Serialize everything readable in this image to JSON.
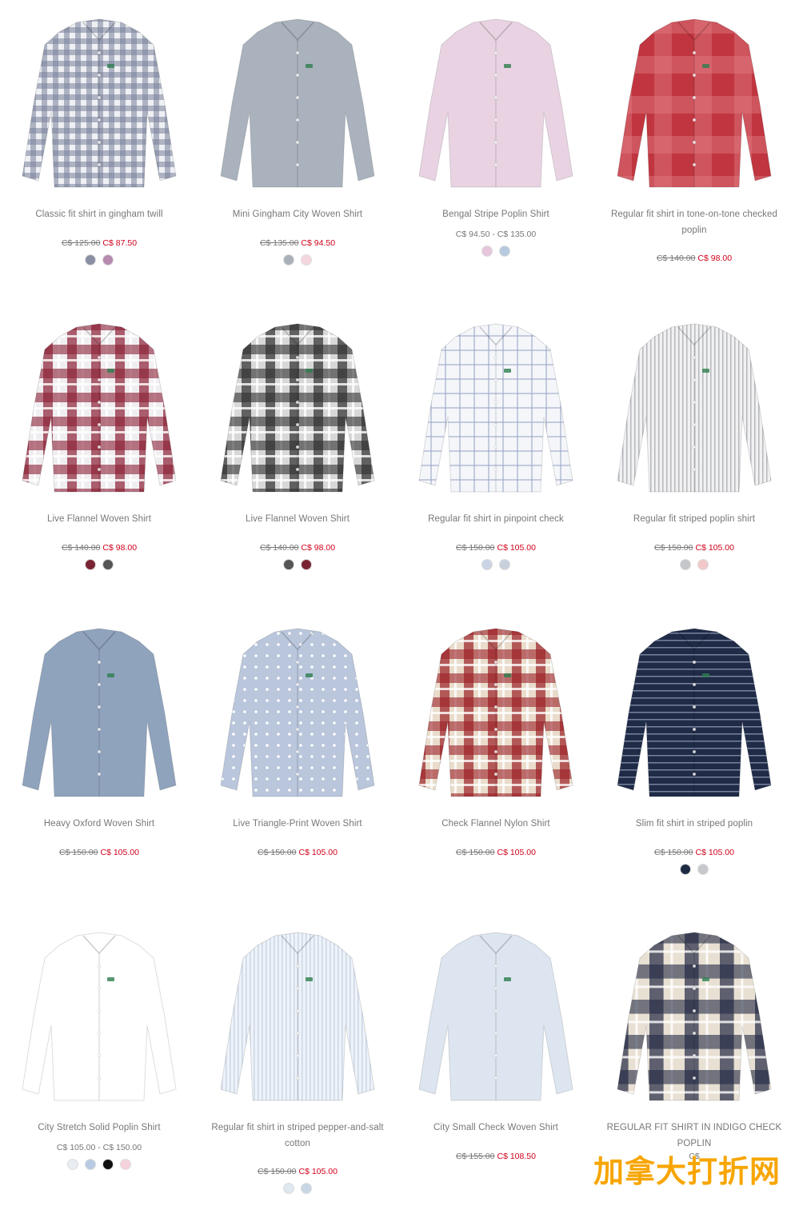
{
  "products": [
    {
      "name": "Classic fit shirt in gingham twill",
      "price_old": "C$ 125.00",
      "price_new": "C$ 87.50",
      "swatches": [
        "#8a8fa3",
        "#b78ab0"
      ],
      "shirt": {
        "base": "#eef0f4",
        "line": "#7a829a",
        "pattern": "gingham"
      }
    },
    {
      "name": "Mini Gingham City Woven Shirt",
      "price_old": "C$ 135.00",
      "price_new": "C$ 94.50",
      "swatches": [
        "#a9b0b8",
        "#f4d7de"
      ],
      "shirt": {
        "base": "#a9b2bd",
        "line": "#8f99a5",
        "pattern": "solid"
      }
    },
    {
      "name": "Bengal Stripe Poplin Shirt",
      "price_range": "C$ 94.50 - C$ 135.00",
      "swatches": [
        "#e5c6dc",
        "#b7c9de"
      ],
      "shirt": {
        "base": "#e9d3e3",
        "line": "#d6bdd0",
        "pattern": "solid"
      }
    },
    {
      "name": "Regular fit shirt in tone-on-tone checked poplin",
      "price_old": "C$ 140.00",
      "price_new": "C$ 98.00",
      "swatches": [],
      "shirt": {
        "base": "#c0353f",
        "line": "#e07a83",
        "pattern": "bigcheck"
      }
    },
    {
      "name": "Live Flannel Woven Shirt",
      "price_old": "C$ 140.00",
      "price_new": "C$ 98.00",
      "swatches": [
        "#7a2433",
        "#555555"
      ],
      "shirt": {
        "base": "#f1eef2",
        "line": "#8b1f34",
        "pattern": "tartan"
      }
    },
    {
      "name": "Live Flannel Woven Shirt",
      "price_old": "C$ 140.00",
      "price_new": "C$ 98.00",
      "swatches": [
        "#555555",
        "#7a2433"
      ],
      "shirt": {
        "base": "#d8d8d8",
        "line": "#2f2f2f",
        "pattern": "tartan"
      }
    },
    {
      "name": "Regular fit shirt in pinpoint check",
      "price_old": "C$ 150.00",
      "price_new": "C$ 105.00",
      "swatches": [
        "#c9d4e4",
        "#c8d0dc"
      ],
      "shirt": {
        "base": "#f4f6fa",
        "line": "#9aa8c4",
        "pattern": "check"
      }
    },
    {
      "name": "Regular fit striped poplin shirt",
      "price_old": "C$ 150.00",
      "price_new": "C$ 105.00",
      "swatches": [
        "#c4c6ca",
        "#f2c8c8"
      ],
      "shirt": {
        "base": "#f1f1f1",
        "line": "#9a9ea6",
        "pattern": "vstripe"
      }
    },
    {
      "name": "Heavy Oxford Woven Shirt",
      "price_old": "C$ 150.00",
      "price_new": "C$ 105.00",
      "swatches": [],
      "shirt": {
        "base": "#8fa3bd",
        "line": "#7e92ad",
        "pattern": "solid"
      }
    },
    {
      "name": "Live Triangle-Print Woven Shirt",
      "price_old": "C$ 150.00",
      "price_new": "C$ 105.00",
      "swatches": [],
      "shirt": {
        "base": "#b9c6dc",
        "line": "#ffffff",
        "pattern": "dots"
      }
    },
    {
      "name": "Check Flannel Nylon Shirt",
      "price_old": "C$ 150.00",
      "price_new": "C$ 105.00",
      "swatches": [],
      "shirt": {
        "base": "#e9dccb",
        "line": "#9b1f27",
        "pattern": "tartan"
      }
    },
    {
      "name": "Slim fit shirt in striped poplin",
      "price_old": "C$ 150.00",
      "price_new": "C$ 105.00",
      "swatches": [
        "#1e2a44",
        "#c6c8cc"
      ],
      "shirt": {
        "base": "#1f2b47",
        "line": "#8f9ab2",
        "pattern": "hstripe"
      }
    },
    {
      "name": "City Stretch Solid Poplin Shirt",
      "price_range": "C$ 105.00 - C$ 150.00",
      "swatches": [
        "#e9edf2",
        "#b9cbe2",
        "#111111",
        "#f6d3dc"
      ],
      "shirt": {
        "base": "#ffffff",
        "line": "#e8e8e8",
        "pattern": "solid"
      }
    },
    {
      "name": "Regular fit shirt in striped pepper-and-salt cotton",
      "price_old": "C$ 150.00",
      "price_new": "C$ 105.00",
      "swatches": [
        "#dfe7f1",
        "#c9d6e6"
      ],
      "shirt": {
        "base": "#eef3f9",
        "line": "#b9c9de",
        "pattern": "vstripe"
      }
    },
    {
      "name": "City Small Check Woven Shirt",
      "price_old": "C$ 155.00",
      "price_new": "C$ 108.50",
      "swatches": [],
      "shirt": {
        "base": "#dde6f0",
        "line": "#cbd6e3",
        "pattern": "solid"
      }
    },
    {
      "name": "REGULAR FIT SHIRT IN INDIGO CHECK POPLIN",
      "price_partial": "C$",
      "swatches": [],
      "shirt": {
        "base": "#e8e0d3",
        "line": "#232a45",
        "pattern": "bigtartan"
      }
    }
  ],
  "watermark": "加拿大打折网"
}
